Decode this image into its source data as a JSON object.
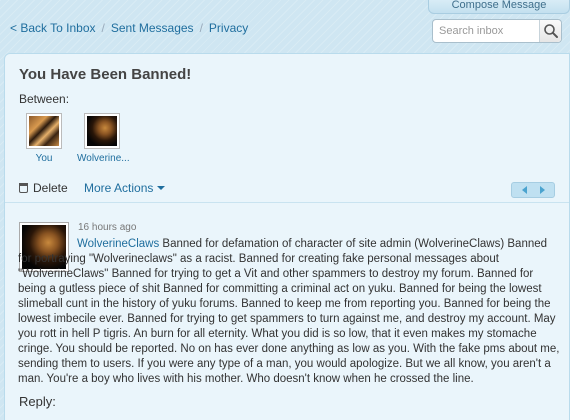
{
  "compose": {
    "label": "Compose Message"
  },
  "nav": {
    "items": [
      "< Back To Inbox",
      "Sent Messages",
      "Privacy"
    ]
  },
  "search": {
    "placeholder": "Search inbox",
    "value": ""
  },
  "conversation": {
    "title": "You Have Been Banned!",
    "between_label": "Between:",
    "participants": [
      {
        "name": "You",
        "avatar_icon": "tiger-avatar"
      },
      {
        "name": "Wolverine...",
        "avatar_icon": "eagle-avatar"
      }
    ]
  },
  "actions": {
    "delete_label": "Delete",
    "more_actions_label": "More Actions"
  },
  "message": {
    "time": "16 hours ago",
    "author": "WolverineClaws",
    "text": " Banned for defamation of character of site admin (WolverineClaws) Banned for portraying \"Wolverineclaws\" as a racist. Banned for creating fake personal messages about \"WolverineClaws\" Banned for trying to get a Vit and other spammers to destroy my forum. Banned for being a gutless piece of shit Banned for committing a criminal act on yuku. Banned for being the lowest slimeball cunt in the history of yuku forums. Banned to keep me from reporting you. Banned for being the lowest imbecile ever. Banned for trying to get spammers to turn against me, and destroy my account. May you rott in hell P tigris. An burn for all eternity. What you did is so low, that it even makes my stomache cringe. You should be reported. No on has ever done anything as low as you. With the fake pms about me, sending them to users. If you were any type of a man, you would apologize. But we all know, you aren't a man. You're a boy who lives with his mother. Who doesn't know when he crossed the line."
  },
  "reply": {
    "label": "Reply:"
  },
  "colors": {
    "link": "#1f6e9e",
    "background": "#cfe6f2",
    "panel": "#eaf5fb"
  }
}
